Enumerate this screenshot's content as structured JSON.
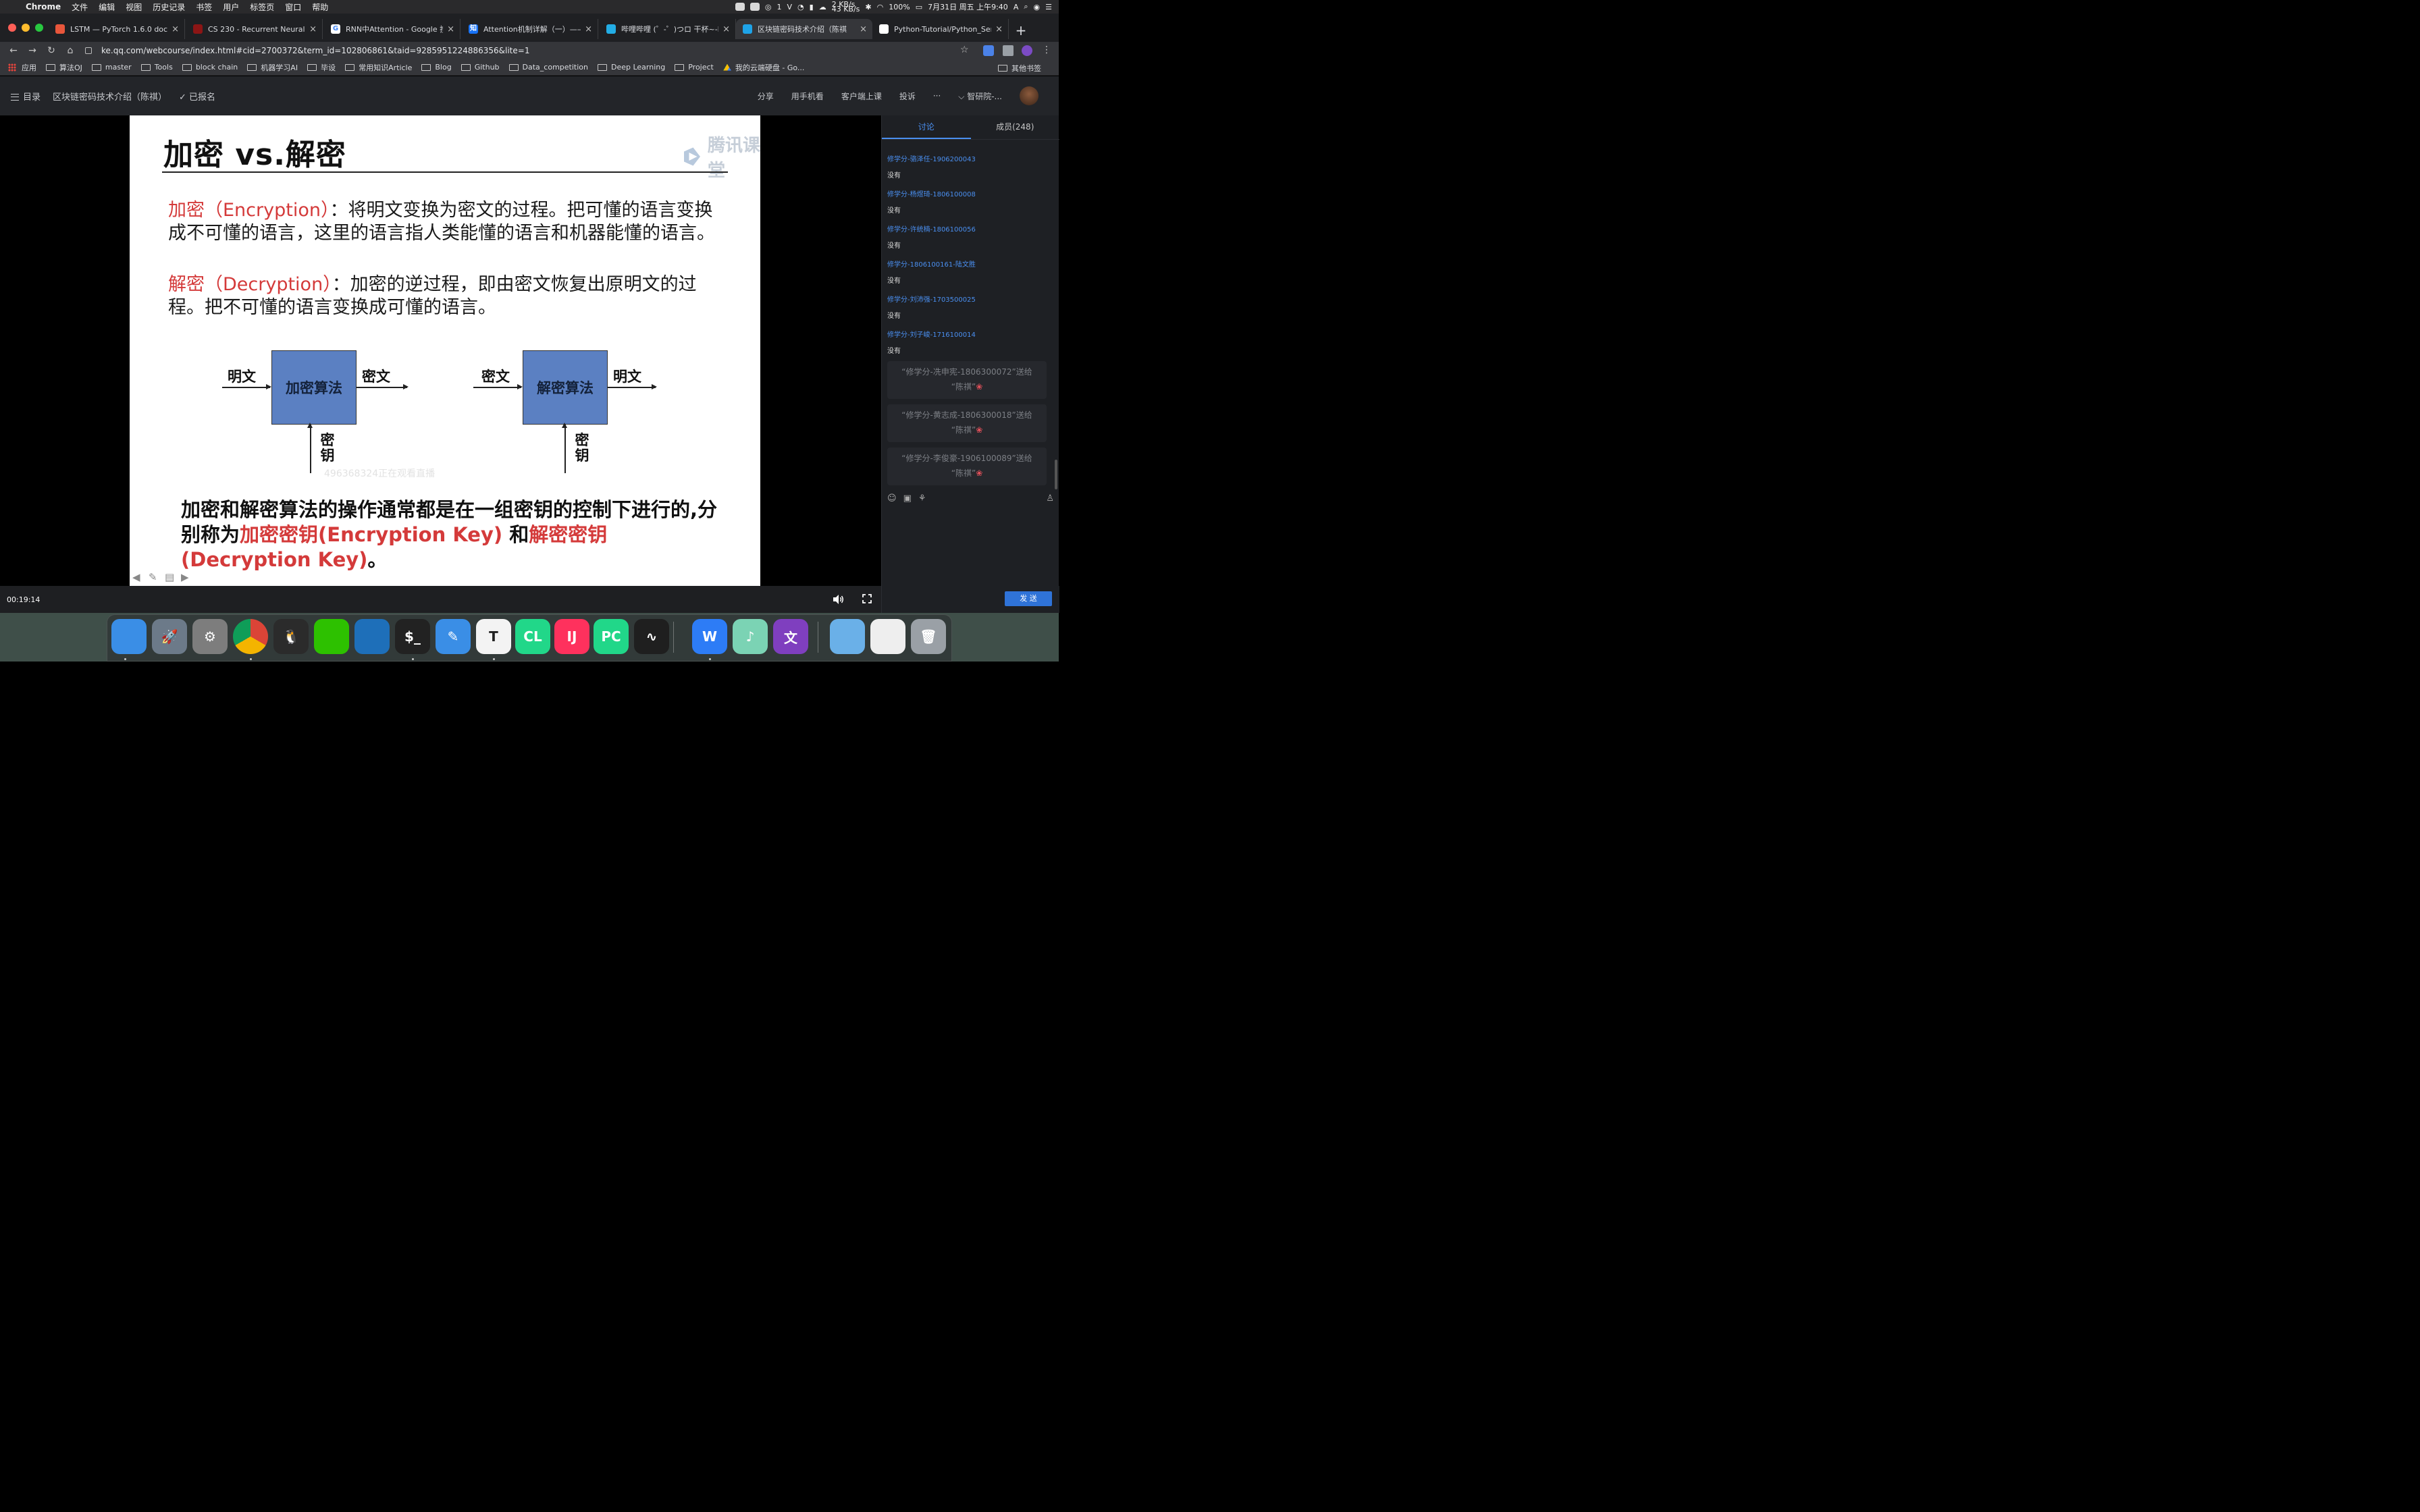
{
  "menubar": {
    "app": "Chrome",
    "items": [
      "文件",
      "编辑",
      "视图",
      "历史记录",
      "书签",
      "用户",
      "标签页",
      "窗口",
      "帮助"
    ],
    "wechat_badge": "1",
    "net_up": "2 KB/s",
    "net_down": "43 KB/s",
    "battery": "100%",
    "clock": "7月31日 周五 上午9:40"
  },
  "tabs": [
    {
      "title": "LSTM — PyTorch 1.6.0 docum",
      "color": "#e8563b",
      "glyph": ""
    },
    {
      "title": "CS 230 - Recurrent Neural Ne",
      "color": "#8c1515",
      "glyph": ""
    },
    {
      "title": "RNN中Attention - Google 搜索",
      "color": "#ffffff",
      "glyph": "G"
    },
    {
      "title": "Attention机制详解（一）——S",
      "color": "#1772f6",
      "glyph": "知"
    },
    {
      "title": "哔哩哔哩 (゜-゜)つロ 干杯~-bi",
      "color": "#23ade5",
      "glyph": ""
    },
    {
      "title": "区块链密码技术介绍（陈祺",
      "color": "#1ea3e8",
      "glyph": ""
    },
    {
      "title": "Python-Tutorial/Python_Senio",
      "color": "#ffffff",
      "glyph": ""
    }
  ],
  "address_bar": {
    "url": "ke.qq.com/webcourse/index.html#cid=2700372&term_id=102806861&taid=9285951224886356&lite=1"
  },
  "bookmarks": {
    "apps": "应用",
    "folders": [
      "算法OJ",
      "master",
      "Tools",
      "block chain",
      "机器学习AI",
      "毕设",
      "常用知识Article",
      "Blog",
      "Github",
      "Data_competition",
      "Deep Learning",
      "Project"
    ],
    "drive": "我的云端硬盘 - Go...",
    "other": "其他书签"
  },
  "page_header": {
    "menu_label": "目录",
    "course_title": "区块链密码技术介绍（陈祺）",
    "enrolled": "✓ 已报名",
    "actions": [
      "分享",
      "用手机看",
      "客户端上课",
      "投诉",
      "···"
    ],
    "user": "智研院-..."
  },
  "slide": {
    "title": "加密 vs.解密",
    "watermark": "腾讯课堂",
    "p1_term": "加密（Encryption）",
    "p1_text": "：将明文变换为密文的过程。把可懂的语言变换成不可懂的语言，这里的语言指人类能懂的语言和机器能懂的语言。",
    "p2_term": "解密（Decryption）",
    "p2_text": "：加密的逆过程，即由密文恢复出原明文的过程。把不可懂的语言变换成可懂的语言。",
    "diagram": {
      "enc_in": "明文",
      "enc_box": "加密算法",
      "enc_out": "密文",
      "enc_key": "密钥",
      "dec_in": "密文",
      "dec_box": "解密算法",
      "dec_out": "明文",
      "dec_key": "密钥"
    },
    "viewer_watermark": "496368324正在观看直播",
    "p3_a": "加密和解密算法的操作通常都是在一组密钥的控制下进行的,分别称为",
    "p3_enc_key": "加密密钥(Encryption  Key)",
    "p3_and": "  和",
    "p3_dec_key": "解密密钥(Decryption Key)",
    "p3_end": "。"
  },
  "video": {
    "time": "00:19:14"
  },
  "chat": {
    "tab_discussion": "讨论",
    "tab_members": "成员(248)",
    "messages": [
      {
        "name": "修学分-骆泽任-1906200043",
        "text": "没有"
      },
      {
        "name": "修学分-杨煜琦-1806100008",
        "text": "没有"
      },
      {
        "name": "修学分-许统楠-1806100056",
        "text": "没有"
      },
      {
        "name": "修学分-1806100161-陆文胜",
        "text": "没有"
      },
      {
        "name": "修学分-刘沛强-1703500025",
        "text": "没有"
      },
      {
        "name": "修学分-刘子峻-1716100014",
        "text": "没有"
      }
    ],
    "gifts": [
      {
        "line1": "“修学分-冼申宪-1806300072”送给",
        "line2": "“陈祺”"
      },
      {
        "line1": "“修学分-黄志成-1806300018”送给",
        "line2": "“陈祺”"
      },
      {
        "line1": "“修学分-李俊豪-1906100089”送给",
        "line2": "“陈祺”"
      }
    ],
    "send_label": "发 送"
  },
  "dock": {
    "apps": [
      {
        "icon": "finder-icon",
        "color": "#3a8ee6",
        "glyph": ""
      },
      {
        "icon": "launchpad-icon",
        "color": "#6c7a89",
        "glyph": "🚀"
      },
      {
        "icon": "system-preferences-icon",
        "color": "#7d7d7d",
        "glyph": "⚙"
      },
      {
        "icon": "chrome-icon",
        "color": "#ffffff",
        "glyph": ""
      },
      {
        "icon": "qq-icon",
        "color": "#2b2b2b",
        "glyph": "🐧"
      },
      {
        "icon": "wechat-icon",
        "color": "#2dc100",
        "glyph": ""
      },
      {
        "icon": "vscode-icon",
        "color": "#1e6fb9",
        "glyph": ""
      },
      {
        "icon": "terminal-icon",
        "color": "#222222",
        "glyph": "$_"
      },
      {
        "icon": "notes-icon",
        "color": "#3a8ee6",
        "glyph": "✎"
      },
      {
        "icon": "typora-icon",
        "color": "#f3f3f3",
        "glyph": "T"
      },
      {
        "icon": "clion-icon",
        "color": "#21d789",
        "glyph": "CL"
      },
      {
        "icon": "intellij-icon",
        "color": "#fe315d",
        "glyph": "IJ"
      },
      {
        "icon": "pycharm-icon",
        "color": "#21d789",
        "glyph": "PC"
      },
      {
        "icon": "activity-monitor-icon",
        "color": "#1f1f1f",
        "glyph": "∿"
      },
      {
        "icon": "wps-icon",
        "color": "#2d7cf6",
        "glyph": "W"
      },
      {
        "icon": "music-icon",
        "color": "#7bd3b4",
        "glyph": "♪"
      },
      {
        "icon": "translator-icon",
        "color": "#7f3fbf",
        "glyph": "文"
      },
      {
        "icon": "folder-icon",
        "color": "#6ab0e8",
        "glyph": ""
      },
      {
        "icon": "document-preview-icon",
        "color": "#eeeeee",
        "glyph": ""
      },
      {
        "icon": "trash-icon",
        "color": "#9aa0a6",
        "glyph": "🗑"
      }
    ]
  }
}
